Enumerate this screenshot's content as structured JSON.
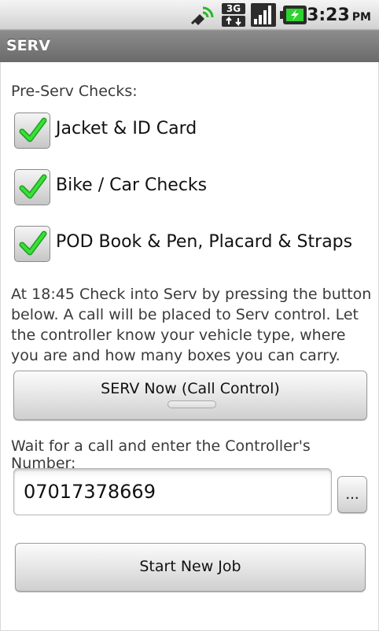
{
  "status_bar": {
    "icons": [
      "gps-satellite-icon",
      "3g-data-icon",
      "signal-strength-icon",
      "battery-charging-icon"
    ],
    "network_label": "3G",
    "time": "3:23",
    "ampm": "PM"
  },
  "app": {
    "title": "SERV"
  },
  "checks": {
    "heading": "Pre-Serv Checks:",
    "items": [
      {
        "label": "Jacket & ID Card",
        "checked": true
      },
      {
        "label": "Bike / Car Checks",
        "checked": true
      },
      {
        "label": "POD Book & Pen, Placard & Straps",
        "checked": true
      }
    ]
  },
  "instructions": "At 18:45 Check into Serv by pressing the button below. A call will be placed to Serv control. Let the controller know your vehicle type, where you are and how many boxes you can carry.",
  "serv_button": {
    "label": "SERV Now (Call Control)"
  },
  "controller": {
    "prompt": "Wait for a call and enter the Controller's Number:",
    "number": "07017378669",
    "more_label": "..."
  },
  "start_button": {
    "label": "Start New Job"
  },
  "colors": {
    "check_green": "#2fd22f",
    "title_bar": "#7b7b7b"
  }
}
